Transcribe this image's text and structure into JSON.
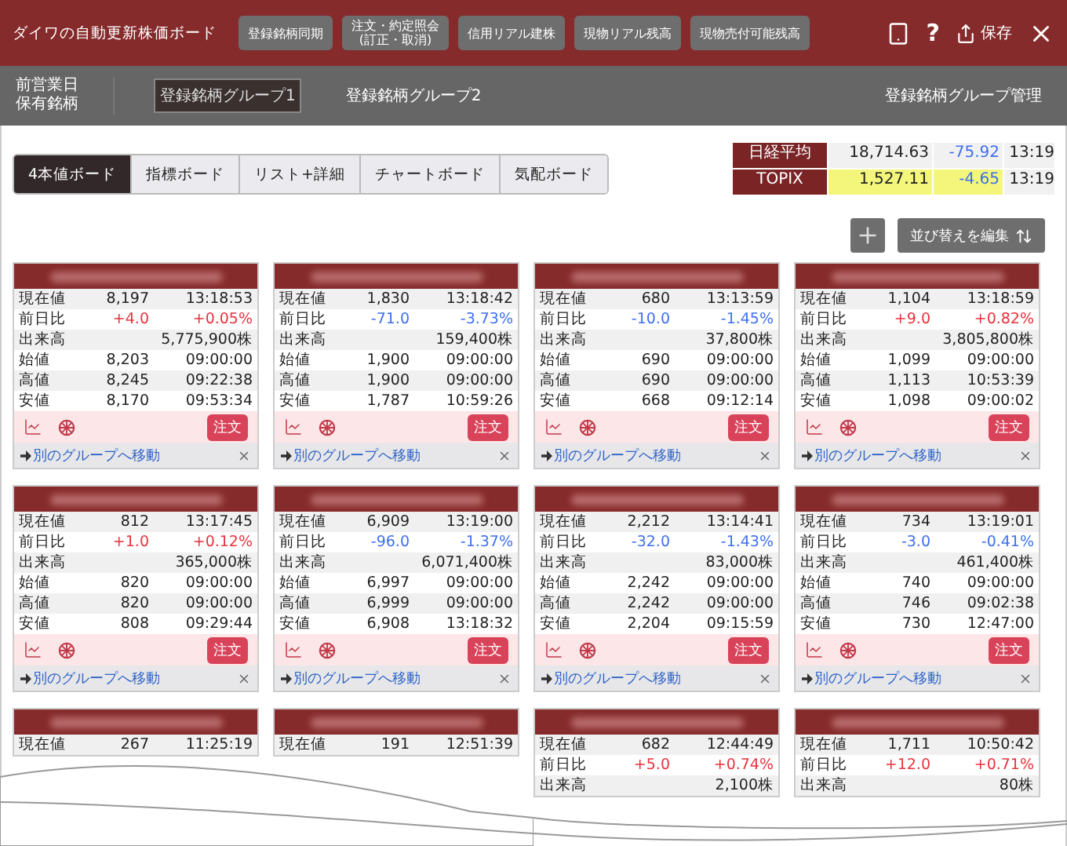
{
  "header": {
    "title": "ダイワの自動更新株価ボード",
    "buttons": [
      [
        "登録銘柄同期"
      ],
      [
        "注文・約定照会",
        "(訂正・取消)"
      ],
      [
        "信用リアル建株"
      ],
      [
        "現物リアル残高"
      ],
      [
        "現物売付可能残高"
      ]
    ],
    "help": "?",
    "save": "保存"
  },
  "subheader": {
    "holdings": [
      "前営業日",
      "保有銘柄"
    ],
    "groups": [
      {
        "label": "登録銘柄グループ1",
        "selected": true
      },
      {
        "label": "登録銘柄グループ2",
        "selected": false
      }
    ],
    "manage": "登録銘柄グループ管理"
  },
  "tabs": [
    {
      "label": "4本値ボード",
      "selected": true
    },
    {
      "label": "指標ボード",
      "selected": false
    },
    {
      "label": "リスト+詳細",
      "selected": false
    },
    {
      "label": "チャートボード",
      "selected": false
    },
    {
      "label": "気配ボード",
      "selected": false
    }
  ],
  "indices": [
    {
      "name": "日経平均",
      "value": "18,714.63",
      "change": "-75.92",
      "time": "13:19",
      "highlight": false,
      "up": false
    },
    {
      "name": "TOPIX",
      "value": "1,527.11",
      "change": "-4.65",
      "time": "13:19",
      "highlight": true,
      "up": false
    }
  ],
  "sort_button": "並び替えを編集",
  "cards": [
    {
      "order": "注文",
      "move": "別のグループへ移動",
      "rows": [
        {
          "label": "現在値",
          "value": "8,197",
          "time": "13:18:53"
        },
        {
          "label": "前日比",
          "value": "+4.0",
          "time": "+0.05%",
          "up": true
        },
        {
          "label": "出来高",
          "value": "",
          "time": "5,775,900株"
        },
        {
          "label": "始値",
          "value": "8,203",
          "time": "09:00:00"
        },
        {
          "label": "高値",
          "value": "8,245",
          "time": "09:22:38"
        },
        {
          "label": "安値",
          "value": "8,170",
          "time": "09:53:34"
        }
      ]
    },
    {
      "order": "注文",
      "move": "別のグループへ移動",
      "rows": [
        {
          "label": "現在値",
          "value": "1,830",
          "time": "13:18:42"
        },
        {
          "label": "前日比",
          "value": "-71.0",
          "time": "-3.73%",
          "up": false
        },
        {
          "label": "出来高",
          "value": "",
          "time": "159,400株"
        },
        {
          "label": "始値",
          "value": "1,900",
          "time": "09:00:00"
        },
        {
          "label": "高値",
          "value": "1,900",
          "time": "09:00:00"
        },
        {
          "label": "安値",
          "value": "1,787",
          "time": "10:59:26"
        }
      ]
    },
    {
      "order": "注文",
      "move": "別のグループへ移動",
      "rows": [
        {
          "label": "現在値",
          "value": "680",
          "time": "13:13:59"
        },
        {
          "label": "前日比",
          "value": "-10.0",
          "time": "-1.45%",
          "up": false
        },
        {
          "label": "出来高",
          "value": "",
          "time": "37,800株"
        },
        {
          "label": "始値",
          "value": "690",
          "time": "09:00:00"
        },
        {
          "label": "高値",
          "value": "690",
          "time": "09:00:00"
        },
        {
          "label": "安値",
          "value": "668",
          "time": "09:12:14"
        }
      ]
    },
    {
      "order": "注文",
      "move": "別のグループへ移動",
      "rows": [
        {
          "label": "現在値",
          "value": "1,104",
          "time": "13:18:59"
        },
        {
          "label": "前日比",
          "value": "+9.0",
          "time": "+0.82%",
          "up": true
        },
        {
          "label": "出来高",
          "value": "",
          "time": "3,805,800株"
        },
        {
          "label": "始値",
          "value": "1,099",
          "time": "09:00:00"
        },
        {
          "label": "高値",
          "value": "1,113",
          "time": "10:53:39"
        },
        {
          "label": "安値",
          "value": "1,098",
          "time": "09:00:02"
        }
      ]
    },
    {
      "order": "注文",
      "move": "別のグループへ移動",
      "rows": [
        {
          "label": "現在値",
          "value": "812",
          "time": "13:17:45"
        },
        {
          "label": "前日比",
          "value": "+1.0",
          "time": "+0.12%",
          "up": true
        },
        {
          "label": "出来高",
          "value": "",
          "time": "365,000株"
        },
        {
          "label": "始値",
          "value": "820",
          "time": "09:00:00"
        },
        {
          "label": "高値",
          "value": "820",
          "time": "09:00:00"
        },
        {
          "label": "安値",
          "value": "808",
          "time": "09:29:44"
        }
      ]
    },
    {
      "order": "注文",
      "move": "別のグループへ移動",
      "rows": [
        {
          "label": "現在値",
          "value": "6,909",
          "time": "13:19:00"
        },
        {
          "label": "前日比",
          "value": "-96.0",
          "time": "-1.37%",
          "up": false
        },
        {
          "label": "出来高",
          "value": "",
          "time": "6,071,400株"
        },
        {
          "label": "始値",
          "value": "6,997",
          "time": "09:00:00"
        },
        {
          "label": "高値",
          "value": "6,999",
          "time": "09:00:00"
        },
        {
          "label": "安値",
          "value": "6,908",
          "time": "13:18:32"
        }
      ]
    },
    {
      "order": "注文",
      "move": "別のグループへ移動",
      "rows": [
        {
          "label": "現在値",
          "value": "2,212",
          "time": "13:14:41"
        },
        {
          "label": "前日比",
          "value": "-32.0",
          "time": "-1.43%",
          "up": false
        },
        {
          "label": "出来高",
          "value": "",
          "time": "83,000株"
        },
        {
          "label": "始値",
          "value": "2,242",
          "time": "09:00:00"
        },
        {
          "label": "高値",
          "value": "2,242",
          "time": "09:00:00"
        },
        {
          "label": "安値",
          "value": "2,204",
          "time": "09:15:59"
        }
      ]
    },
    {
      "order": "注文",
      "move": "別のグループへ移動",
      "rows": [
        {
          "label": "現在値",
          "value": "734",
          "time": "13:19:01"
        },
        {
          "label": "前日比",
          "value": "-3.0",
          "time": "-0.41%",
          "up": false
        },
        {
          "label": "出来高",
          "value": "",
          "time": "461,400株"
        },
        {
          "label": "始値",
          "value": "740",
          "time": "09:00:00"
        },
        {
          "label": "高値",
          "value": "746",
          "time": "09:02:38"
        },
        {
          "label": "安値",
          "value": "730",
          "time": "12:47:00"
        }
      ]
    },
    {
      "rows": [
        {
          "label": "現在値",
          "value": "267",
          "time": "11:25:19"
        }
      ]
    },
    {
      "rows": [
        {
          "label": "現在値",
          "value": "191",
          "time": "12:51:39"
        }
      ]
    },
    {
      "rows": [
        {
          "label": "現在値",
          "value": "682",
          "time": "12:44:49"
        },
        {
          "label": "前日比",
          "value": "+5.0",
          "time": "+0.74%",
          "up": true
        },
        {
          "label": "出来高",
          "value": "",
          "time": "2,100株"
        }
      ]
    },
    {
      "rows": [
        {
          "label": "現在値",
          "value": "1,711",
          "time": "10:50:42"
        },
        {
          "label": "前日比",
          "value": "+12.0",
          "time": "+0.71%",
          "up": true
        },
        {
          "label": "出来高",
          "value": "",
          "time": "80株"
        }
      ]
    }
  ]
}
